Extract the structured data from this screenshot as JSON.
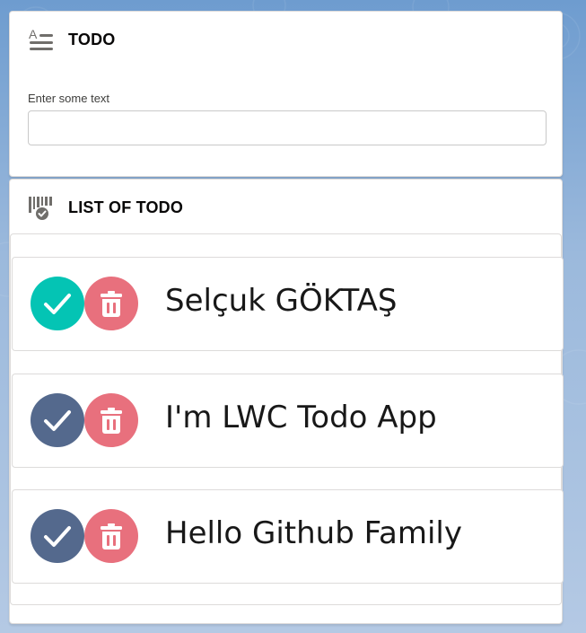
{
  "todo_card": {
    "title": "TODO",
    "icon": "text-list-icon",
    "input_label": "Enter some text",
    "input_value": "",
    "input_placeholder": ""
  },
  "list_card": {
    "title": "LIST OF TODO",
    "icon": "checklist-icon",
    "items": [
      {
        "text": "Selçuk GÖKTAŞ",
        "done": true,
        "done_color": "#04c4b4"
      },
      {
        "text": "I'm LWC Todo App",
        "done": false,
        "done_color": "#54698d"
      },
      {
        "text": "Hello Github Family",
        "done": false,
        "done_color": "#54698d"
      }
    ]
  },
  "colors": {
    "done_active": "#04c4b4",
    "done_inactive": "#54698d",
    "delete": "#e8707d",
    "icon_gray": "#706e6b"
  }
}
